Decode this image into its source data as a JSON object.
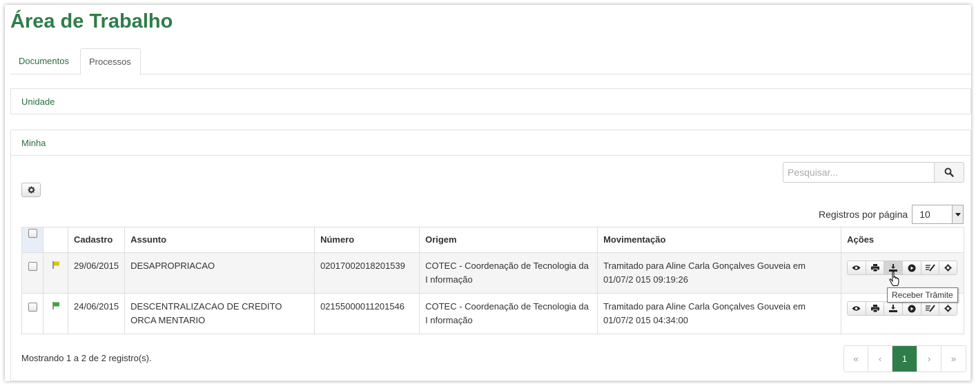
{
  "page": {
    "title": "Área de Trabalho"
  },
  "tabs": [
    {
      "label": "Documentos",
      "active": false
    },
    {
      "label": "Processos",
      "active": true
    }
  ],
  "panels": {
    "unidade": {
      "label": "Unidade"
    },
    "minha": {
      "label": "Minha"
    }
  },
  "search": {
    "placeholder": "Pesquisar..."
  },
  "per_page": {
    "label": "Registros por página",
    "value": "10"
  },
  "table": {
    "headers": [
      "Cadastro",
      "Assunto",
      "Número",
      "Origem",
      "Movimentação",
      "Ações"
    ],
    "rows": [
      {
        "flag_color": "#d8c800",
        "cadastro": "29/06/2015",
        "assunto": "DESAPROPRIACAO",
        "numero": "02017002018201539",
        "origem": "COTEC - Coordenação de Tecnologia da I nformação",
        "movimentacao": "Tramitado para Aline Carla Gonçalves Gouveia em 01/07/2 015 09:19:26"
      },
      {
        "flag_color": "#3aa63a",
        "cadastro": "24/06/2015",
        "assunto": "DESCENTRALIZACAO DE CREDITO ORCA MENTARIO",
        "numero": "02155000011201546",
        "origem": "COTEC - Coordenação de Tecnologia da I nformação",
        "movimentacao": "Tramitado para Aline Carla Gonçalves Gouveia em 01/07/2 015 04:34:00"
      }
    ],
    "action_icons": [
      "eye-icon",
      "print-icon",
      "receive-icon",
      "forward-icon",
      "edit-icon",
      "gear-icon"
    ]
  },
  "tooltip": {
    "text": "Receber Trâmite"
  },
  "footer": {
    "info": "Mostrando 1 a 2 de 2 registro(s)."
  },
  "pagination": {
    "first": "«",
    "prev": "‹",
    "current": "1",
    "next": "›",
    "last": "»"
  },
  "colors": {
    "brand": "#2e7d4a",
    "link": "#2a6e3f"
  }
}
